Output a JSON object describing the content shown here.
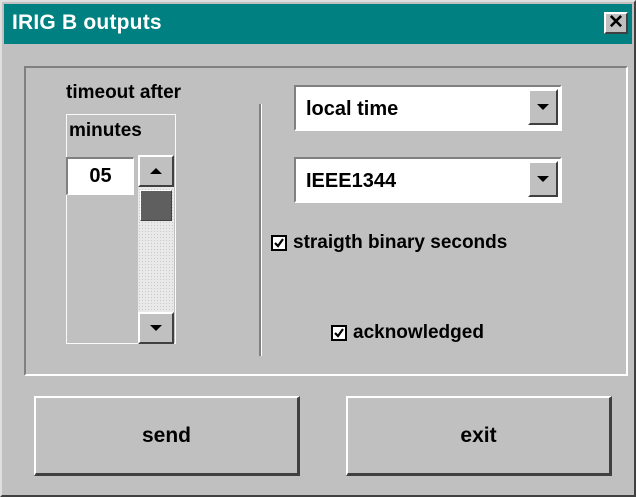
{
  "window": {
    "title": "IRIG B outputs",
    "close_label": "✕"
  },
  "timeout": {
    "label_line1": "timeout after",
    "label_line2": "minutes",
    "value": "05"
  },
  "time_mode": {
    "selected": "local time"
  },
  "format": {
    "selected": "IEEE1344"
  },
  "options": {
    "straight_binary_seconds": {
      "label": "straigth binary seconds",
      "checked": true
    },
    "acknowledged": {
      "label": "acknowledged",
      "checked": true
    }
  },
  "buttons": {
    "send": "send",
    "exit": "exit"
  },
  "colors": {
    "titlebar": "#008080",
    "face": "#c0c0c0"
  }
}
